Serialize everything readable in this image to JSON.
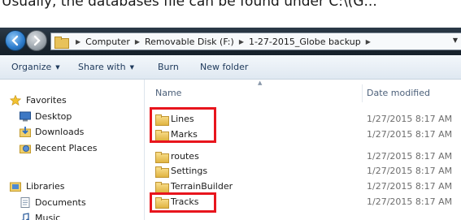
{
  "caption": {
    "text": "Usually, the databases file can be found under C:\\(G..."
  },
  "address_bar": {
    "segments": [
      "Computer",
      "Removable Disk (F:)",
      "1-27-2015_Globe backup"
    ]
  },
  "toolbar": {
    "organize": "Organize",
    "share_with": "Share with",
    "burn": "Burn",
    "new_folder": "New folder"
  },
  "nav_pane": {
    "favorites": "Favorites",
    "desktop": "Desktop",
    "downloads": "Downloads",
    "recent_places": "Recent Places",
    "libraries": "Libraries",
    "documents": "Documents",
    "music": "Music"
  },
  "columns": {
    "name": "Name",
    "date_modified": "Date modified"
  },
  "files": [
    {
      "name": "Lines",
      "date": "1/27/2015 8:17 AM"
    },
    {
      "name": "Marks",
      "date": "1/27/2015 8:17 AM"
    },
    {
      "name": "routes",
      "date": "1/27/2015 8:17 AM"
    },
    {
      "name": "Settings",
      "date": "1/27/2015 8:17 AM"
    },
    {
      "name": "TerrainBuilder",
      "date": "1/27/2015 8:17 AM"
    },
    {
      "name": "Tracks",
      "date": "1/27/2015 8:17 AM"
    }
  ],
  "colors": {
    "highlight": "#e8151d",
    "titlebar": "#1c2630",
    "toolbar_text": "#1e395b"
  },
  "icons": [
    "back-arrow-icon",
    "forward-arrow-icon",
    "folder-icon",
    "star-icon",
    "desktop-icon",
    "downloads-icon",
    "recent-places-icon",
    "libraries-icon",
    "documents-icon",
    "music-icon"
  ]
}
